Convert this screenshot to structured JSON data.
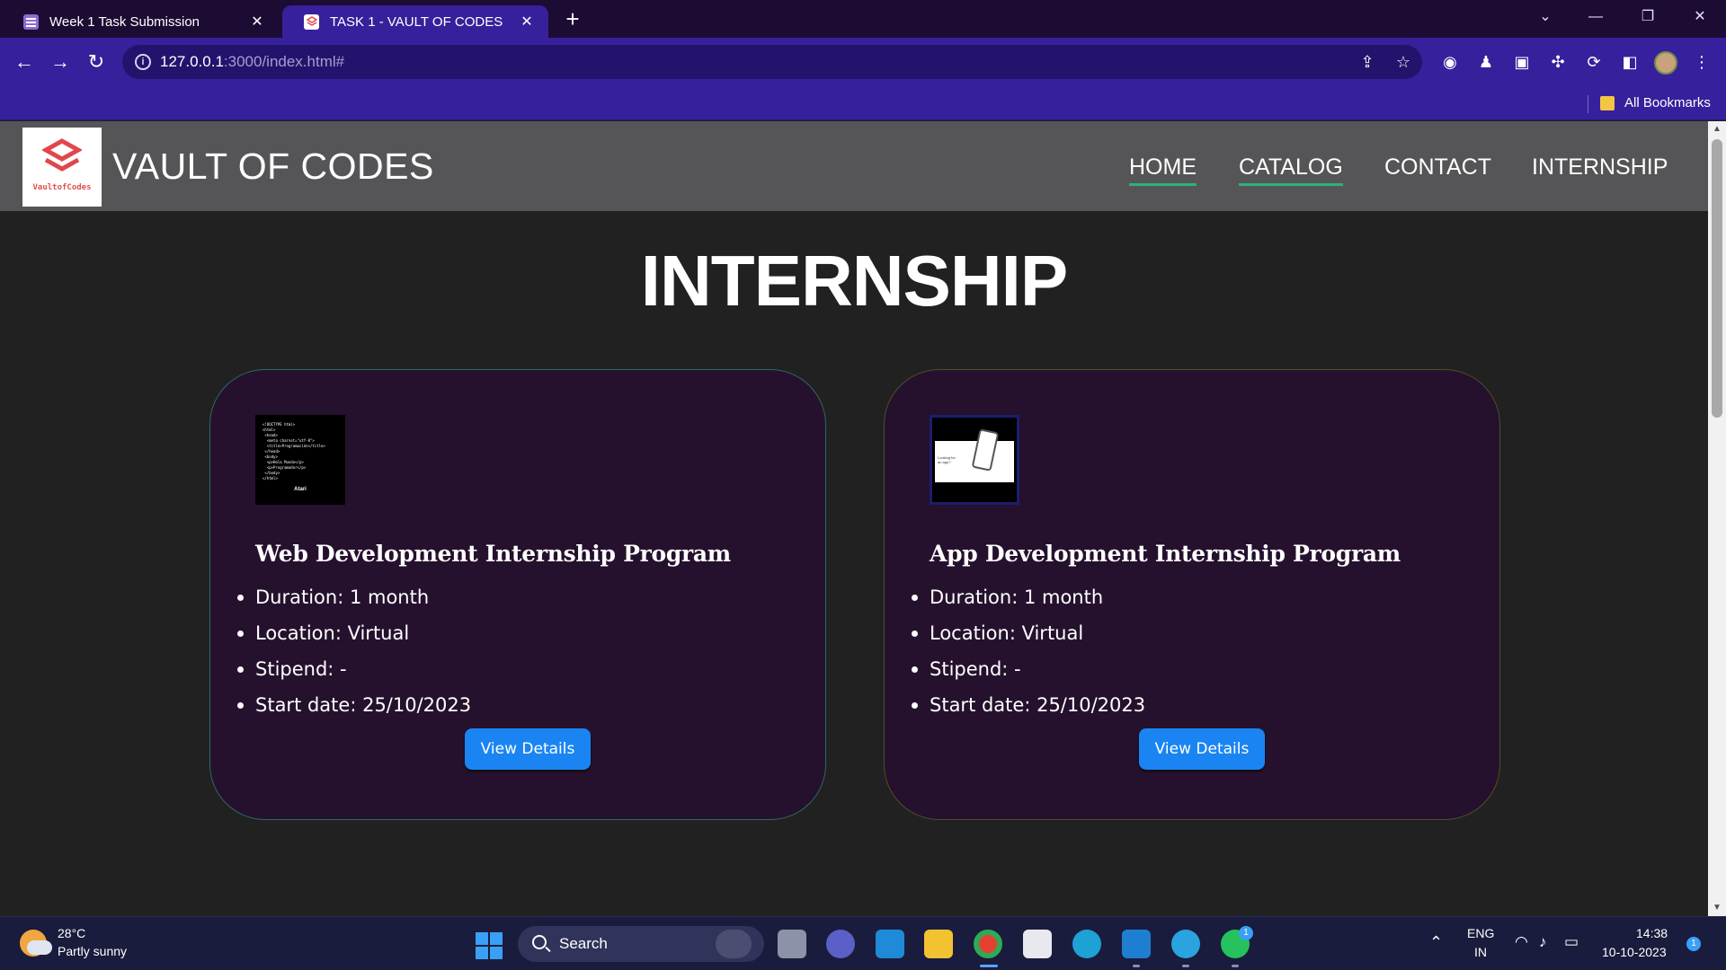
{
  "browser": {
    "tabs": [
      {
        "title": "Week 1 Task Submission"
      },
      {
        "title": "TASK 1 - VAULT OF CODES"
      }
    ],
    "url_host": "127.0.0.1",
    "url_rest": ":3000/index.html#",
    "bookmarks_label": "All Bookmarks"
  },
  "site": {
    "logo_text": "VaultofCodes",
    "brand": "VAULT OF CODES",
    "nav": [
      "HOME",
      "CATALOG",
      "CONTACT",
      "INTERNSHIP"
    ],
    "page_title": "INTERNSHIP",
    "cards": [
      {
        "title": "Web Development Internship Program",
        "details": [
          "Duration: 1 month",
          "Location: Virtual",
          "Stipend: -",
          "Start date: 25/10/2023"
        ],
        "button": "View Details"
      },
      {
        "title": "App Development Internship Program",
        "details": [
          "Duration: 1 month",
          "Location: Virtual",
          "Stipend: -",
          "Start date: 25/10/2023"
        ],
        "button": "View Details"
      }
    ]
  },
  "taskbar": {
    "weather_temp": "28°C",
    "weather_desc": "Partly sunny",
    "search_placeholder": "Search",
    "language": "ENG",
    "region": "IN",
    "time": "14:38",
    "date": "10-10-2023",
    "notification_count": "1",
    "whatsapp_badge": "1"
  },
  "colors": {
    "tabbar": "#1c0c33",
    "toolbar": "#37209b",
    "site_header": "#555557",
    "page_bg": "#212121",
    "card_bg": "#25112d",
    "button": "#1a85f2",
    "active_underline": "#2ab27b"
  }
}
